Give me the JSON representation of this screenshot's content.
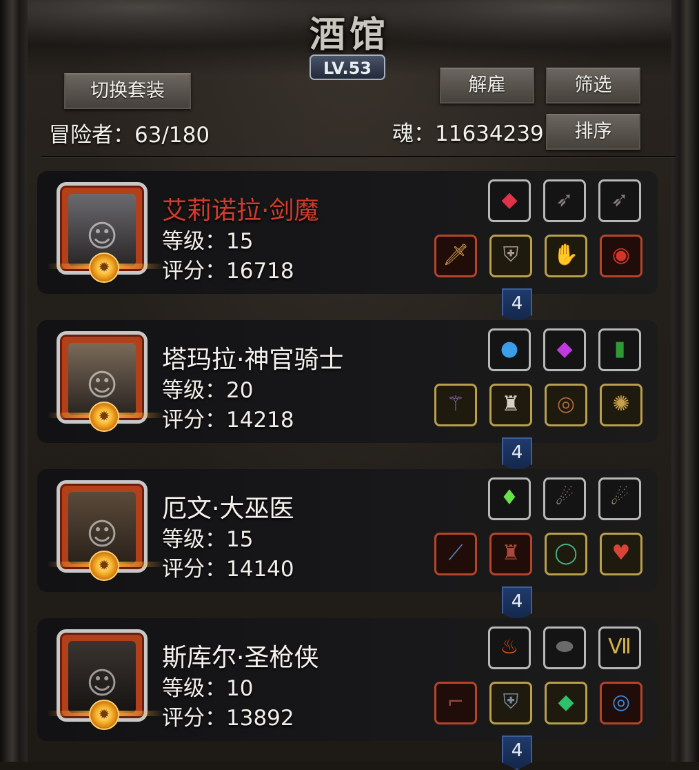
{
  "header": {
    "title": "酒馆",
    "level": "LV.53",
    "switch_outfit_label": "切换套装",
    "dismiss_label": "解雇",
    "filter_label": "筛选",
    "sort_label": "排序",
    "adventurers_text": "冒险者：63/180",
    "soul_text": "魂：11634239"
  },
  "heroes": [
    {
      "name": "艾莉诺拉·剑魔",
      "level_text": "等级：15",
      "score_text": "评分：16718",
      "rank": "4",
      "name_color": "#d23c2e",
      "portrait_icon": "white-haired-swordswoman-portrait",
      "top_items": [
        {
          "icon": "red-gem-icon",
          "glyph": "◆",
          "color": "#e0334a",
          "frame": "silver"
        },
        {
          "icon": "dark-feather-icon",
          "glyph": "➶",
          "color": "#8a7d82",
          "frame": "silver"
        },
        {
          "icon": "dark-feather-icon",
          "glyph": "➶",
          "color": "#8a7d82",
          "frame": "silver"
        }
      ],
      "bottom_items": [
        {
          "icon": "sword-icon",
          "glyph": "🗡",
          "color": "#d9a24a",
          "frame": "redb"
        },
        {
          "icon": "armor-icon",
          "glyph": "⛨",
          "color": "#a79a8a",
          "frame": "gold"
        },
        {
          "icon": "gauntlet-icon",
          "glyph": "✋",
          "color": "#c9a25c",
          "frame": "gold"
        },
        {
          "icon": "red-ring-icon",
          "glyph": "◉",
          "color": "#d3342a",
          "frame": "redb"
        }
      ]
    },
    {
      "name": "塔玛拉·神官骑士",
      "level_text": "等级：20",
      "score_text": "评分：14218",
      "rank": "4",
      "name_color": "#f4f2ee",
      "portrait_icon": "blonde-priestess-portrait",
      "top_items": [
        {
          "icon": "blue-orb-icon",
          "glyph": "●",
          "color": "#3a9ee8",
          "frame": "silver"
        },
        {
          "icon": "purple-gem-icon",
          "glyph": "◆",
          "color": "#c03ae0",
          "frame": "silver"
        },
        {
          "icon": "green-tablet-icon",
          "glyph": "▮",
          "color": "#2f9a35",
          "frame": "silver"
        }
      ],
      "bottom_items": [
        {
          "icon": "scepter-icon",
          "glyph": "⚚",
          "color": "#8a6ab8",
          "frame": "gold"
        },
        {
          "icon": "robe-icon",
          "glyph": "♜",
          "color": "#d8d0c0",
          "frame": "gold"
        },
        {
          "icon": "bracelet-icon",
          "glyph": "◎",
          "color": "#b06a3a",
          "frame": "gold"
        },
        {
          "icon": "amulet-icon",
          "glyph": "✺",
          "color": "#c8a04a",
          "frame": "gold"
        }
      ]
    },
    {
      "name": "厄文·大巫医",
      "level_text": "等级：15",
      "score_text": "评分：14140",
      "rank": "4",
      "name_color": "#f4f2ee",
      "portrait_icon": "bearded-shaman-portrait",
      "top_items": [
        {
          "icon": "green-crystal-icon",
          "glyph": "♦",
          "color": "#6ae04a",
          "frame": "silver"
        },
        {
          "icon": "claw-icon",
          "glyph": "☄",
          "color": "#9a8a7a",
          "frame": "silver"
        },
        {
          "icon": "claw-icon",
          "glyph": "☄",
          "color": "#9a8a7a",
          "frame": "silver"
        }
      ],
      "bottom_items": [
        {
          "icon": "staff-icon",
          "glyph": "⟋",
          "color": "#5a8ac8",
          "frame": "redb"
        },
        {
          "icon": "red-robe-icon",
          "glyph": "♜",
          "color": "#a84a3a",
          "frame": "redb"
        },
        {
          "icon": "green-ring-icon",
          "glyph": "◯",
          "color": "#4ab08a",
          "frame": "gold"
        },
        {
          "icon": "heart-pendant-icon",
          "glyph": "♥",
          "color": "#d8443a",
          "frame": "gold"
        }
      ]
    },
    {
      "name": "斯库尔·圣枪侠",
      "level_text": "等级：10",
      "score_text": "评分：13892",
      "rank": "4",
      "name_color": "#f4f2ee",
      "portrait_icon": "hat-gunslinger-portrait",
      "top_items": [
        {
          "icon": "fire-orb-icon",
          "glyph": "♨",
          "color": "#f0541a",
          "frame": "silver"
        },
        {
          "icon": "stone-icon",
          "glyph": "⬬",
          "color": "#6a6a6a",
          "frame": "silver"
        },
        {
          "icon": "vii-emblem-icon",
          "glyph": "Ⅶ",
          "color": "#d6b24a",
          "frame": "silver"
        }
      ],
      "bottom_items": [
        {
          "icon": "pistol-icon",
          "glyph": "⌐",
          "color": "#8a4a3a",
          "frame": "redb"
        },
        {
          "icon": "coat-icon",
          "glyph": "⛨",
          "color": "#7a8aa0",
          "frame": "gold"
        },
        {
          "icon": "emerald-icon",
          "glyph": "◆",
          "color": "#2ec06a",
          "frame": "gold"
        },
        {
          "icon": "blue-ring-icon",
          "glyph": "◎",
          "color": "#3a8ae0",
          "frame": "redb"
        }
      ]
    }
  ]
}
